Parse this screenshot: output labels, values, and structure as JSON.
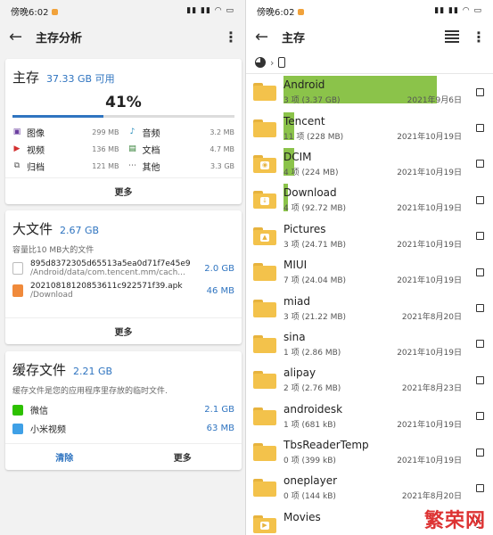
{
  "left": {
    "status": {
      "time": "傍晚6:02",
      "icons": "▮▮ ▮▮ ◠ ▭"
    },
    "title": "主存分析",
    "storage": {
      "heading": "主存",
      "available": "37.33 GB 可用",
      "percent": "41%",
      "fill": 0.41,
      "items": [
        {
          "label": "图像",
          "size": "299 MB",
          "icon": "image-icon",
          "color": "#6b3fa0"
        },
        {
          "label": "音频",
          "size": "3.2 MB",
          "icon": "music-note-icon",
          "color": "#1e88b8"
        },
        {
          "label": "视频",
          "size": "136 MB",
          "icon": "video-play-icon",
          "color": "#d32f2f"
        },
        {
          "label": "文档",
          "size": "4.7 MB",
          "icon": "document-icon",
          "color": "#2e7d32"
        },
        {
          "label": "归档",
          "size": "121 MB",
          "icon": "archive-icon",
          "color": "#555555"
        },
        {
          "label": "其他",
          "size": "3.3 GB",
          "icon": "other-dots-icon",
          "color": "#555555"
        }
      ],
      "more": "更多"
    },
    "bigfiles": {
      "heading": "大文件",
      "size": "2.67 GB",
      "subtitle": "容量比10 MB大的文件",
      "files": [
        {
          "name": "895d8372305d65513a5ea0d71f7e45e9",
          "path": "/Android/data/com.tencent.mm/cach...",
          "size": "2.0 GB"
        },
        {
          "name": "20210818120853611c922571f39.apk",
          "path": "/Download",
          "size": "46 MB"
        }
      ],
      "more": "更多"
    },
    "cache": {
      "heading": "缓存文件",
      "size": "2.21 GB",
      "subtitle": "缓存文件是您的应用程序里存放的临时文件.",
      "apps": [
        {
          "name": "微信",
          "size": "2.1 GB",
          "color": "#2dc100"
        },
        {
          "name": "小米视频",
          "size": "63 MB",
          "color": "#3fa0e6"
        }
      ],
      "clear": "清除",
      "more": "更多"
    }
  },
  "right": {
    "status": {
      "time": "傍晚6:02",
      "icons": "▮▮ ▮▮ ◠ ▭"
    },
    "title": "主存",
    "folders": [
      {
        "name": "Android",
        "info": "3 项 (3.37 GB)",
        "date": "2021年9月6日",
        "fill": 1.0,
        "glyph": ""
      },
      {
        "name": "Tencent",
        "info": "11 项 (228 MB)",
        "date": "2021年10月19日",
        "fill": 0.07,
        "glyph": ""
      },
      {
        "name": "DCIM",
        "info": "4 项 (224 MB)",
        "date": "2021年10月19日",
        "fill": 0.07,
        "glyph": "camera-icon"
      },
      {
        "name": "Download",
        "info": "4 项 (92.72 MB)",
        "date": "2021年10月19日",
        "fill": 0.03,
        "glyph": "download-icon"
      },
      {
        "name": "Pictures",
        "info": "3 项 (24.71 MB)",
        "date": "2021年10月19日",
        "fill": 0.0,
        "glyph": "picture-icon"
      },
      {
        "name": "MIUI",
        "info": "7 项 (24.04 MB)",
        "date": "2021年10月19日",
        "fill": 0.0,
        "glyph": ""
      },
      {
        "name": "miad",
        "info": "3 项 (21.22 MB)",
        "date": "2021年8月20日",
        "fill": 0.0,
        "glyph": ""
      },
      {
        "name": "sina",
        "info": "1 项 (2.86 MB)",
        "date": "2021年10月19日",
        "fill": 0.0,
        "glyph": ""
      },
      {
        "name": "alipay",
        "info": "2 项 (2.76 MB)",
        "date": "2021年8月23日",
        "fill": 0.0,
        "glyph": ""
      },
      {
        "name": "androidesk",
        "info": "1 项 (681 kB)",
        "date": "2021年10月19日",
        "fill": 0.0,
        "glyph": ""
      },
      {
        "name": "TbsReaderTemp",
        "info": "0 项 (399 kB)",
        "date": "2021年10月19日",
        "fill": 0.0,
        "glyph": ""
      },
      {
        "name": "oneplayer",
        "info": "0 项 (144 kB)",
        "date": "2021年8月20日",
        "fill": 0.0,
        "glyph": ""
      },
      {
        "name": "Movies",
        "info": "",
        "date": "",
        "fill": 0.0,
        "glyph": "play-icon"
      }
    ]
  },
  "watermark": "繁荣网"
}
